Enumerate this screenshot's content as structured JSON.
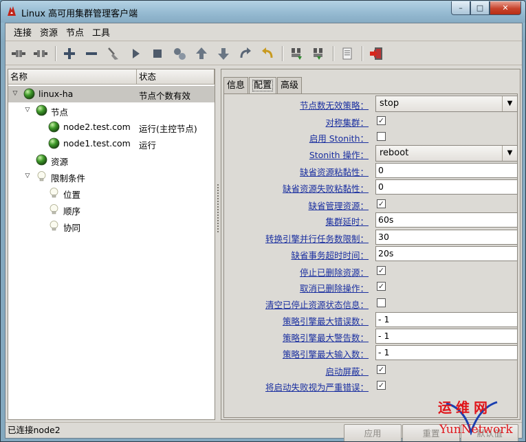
{
  "window": {
    "title": "Linux 高可用集群管理客户端",
    "controls": {
      "minimize": "–",
      "maximize": "□",
      "close": "✕"
    }
  },
  "menubar": [
    "连接",
    "资源",
    "节点",
    "工具"
  ],
  "toolbar": {
    "icons": [
      "connect-icon",
      "disconnect-icon",
      "add-icon",
      "remove-icon",
      "cleanup-icon",
      "start-icon",
      "stop-icon",
      "manage-icon",
      "move-up-icon",
      "move-down-icon",
      "redo-icon",
      "undo-icon",
      "standby-icon",
      "active-icon",
      "log-icon",
      "exit-icon"
    ]
  },
  "tree": {
    "columns": [
      "名称",
      "状态"
    ],
    "rows": [
      {
        "label": "linux-ha",
        "status": "节点个数有效",
        "depth": 0,
        "icon": "green-ball",
        "expanded": true,
        "selected": true
      },
      {
        "label": "节点",
        "status": "",
        "depth": 1,
        "icon": "green-ball",
        "expanded": true
      },
      {
        "label": "node2.test.com",
        "status": "运行(主控节点)",
        "depth": 2,
        "icon": "green-ball"
      },
      {
        "label": "node1.test.com",
        "status": "运行",
        "depth": 2,
        "icon": "green-ball"
      },
      {
        "label": "资源",
        "status": "",
        "depth": 1,
        "icon": "green-ball"
      },
      {
        "label": "限制条件",
        "status": "",
        "depth": 1,
        "icon": "bulb",
        "expanded": true
      },
      {
        "label": "位置",
        "status": "",
        "depth": 2,
        "icon": "bulb"
      },
      {
        "label": "顺序",
        "status": "",
        "depth": 2,
        "icon": "bulb"
      },
      {
        "label": "协同",
        "status": "",
        "depth": 2,
        "icon": "bulb"
      }
    ]
  },
  "tabs": [
    {
      "label": "信息",
      "active": false
    },
    {
      "label": "配置",
      "active": true
    },
    {
      "label": "高级",
      "active": false
    }
  ],
  "config": [
    {
      "label": "节点数无效策略：",
      "type": "combo",
      "value": "stop"
    },
    {
      "label": "对称集群：",
      "type": "checkbox",
      "checked": true
    },
    {
      "label": "启用 Stonith：",
      "type": "checkbox",
      "checked": false
    },
    {
      "label": "Stonith 操作：",
      "type": "combo",
      "value": "reboot"
    },
    {
      "label": "缺省资源粘黏性：",
      "type": "text",
      "value": "0"
    },
    {
      "label": "缺省资源失败粘黏性：",
      "type": "text",
      "value": "0"
    },
    {
      "label": "缺省管理资源：",
      "type": "checkbox",
      "checked": true
    },
    {
      "label": "集群延时：",
      "type": "text",
      "value": "60s"
    },
    {
      "label": "转换引擎并行任务数限制：",
      "type": "text",
      "value": "30"
    },
    {
      "label": "缺省事务超时时间：",
      "type": "text",
      "value": "20s"
    },
    {
      "label": "停止已删除资源：",
      "type": "checkbox",
      "checked": true
    },
    {
      "label": "取消已删除操作：",
      "type": "checkbox",
      "checked": true
    },
    {
      "label": "清空已停止资源状态信息：",
      "type": "checkbox",
      "checked": false
    },
    {
      "label": "策略引擎最大错误数：",
      "type": "text",
      "value": "- 1"
    },
    {
      "label": "策略引擎最大警告数：",
      "type": "text",
      "value": "- 1"
    },
    {
      "label": "策略引擎最大输入数：",
      "type": "text",
      "value": "- 1"
    },
    {
      "label": "启动屏蔽：",
      "type": "checkbox",
      "checked": true
    },
    {
      "label": "将启动失败视为严重错误：",
      "type": "checkbox",
      "checked": true
    }
  ],
  "buttons": {
    "apply": "应用",
    "reset": "重置",
    "default": "默认值"
  },
  "statusbar": {
    "text": "已连接node2"
  },
  "watermark": {
    "logo": "运维网",
    "sub": "YunNetwork"
  },
  "colors": {
    "label_link": "#1a2fa0",
    "selected_row": "#c8c6c1",
    "watermark": "#e0161b"
  }
}
